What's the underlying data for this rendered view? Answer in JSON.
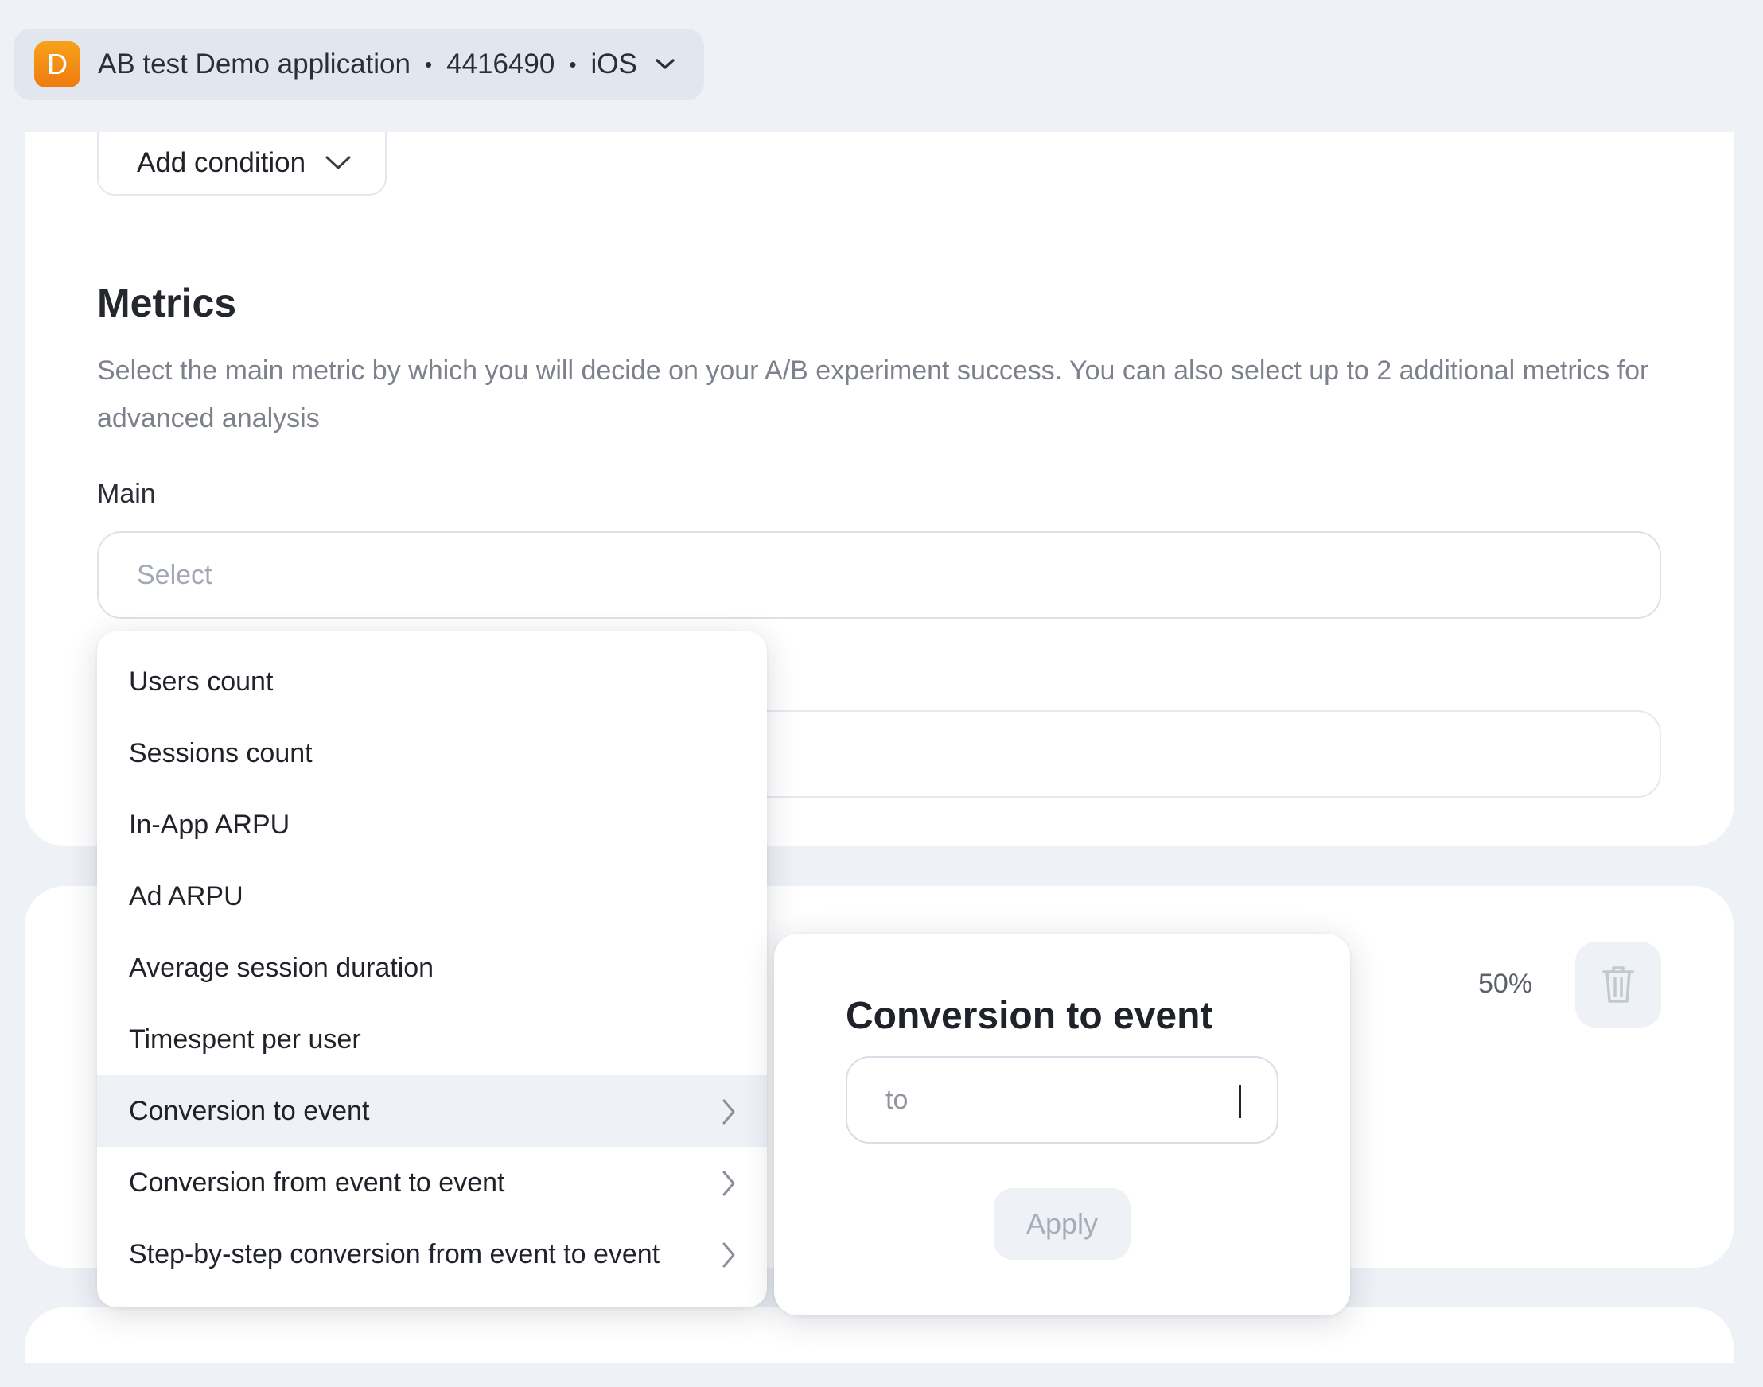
{
  "app_selector": {
    "avatar_letter": "D",
    "app_name": "AB test Demo application",
    "separator": "•",
    "app_id": "4416490",
    "platform": "iOS",
    "avatar_color": "#f08a14"
  },
  "conditions": {
    "add_label": "Add condition"
  },
  "metrics": {
    "title": "Metrics",
    "description": "Select the main metric by which you will decide on your A/B experiment success. You can also select up to 2 additional metrics for advanced analysis",
    "main_label": "Main",
    "main_placeholder": "Select",
    "menu_items": [
      {
        "label": "Users count",
        "has_submenu": false
      },
      {
        "label": "Sessions count",
        "has_submenu": false
      },
      {
        "label": "In-App ARPU",
        "has_submenu": false
      },
      {
        "label": "Ad ARPU",
        "has_submenu": false
      },
      {
        "label": "Average session duration",
        "has_submenu": false
      },
      {
        "label": "Timespent per user",
        "has_submenu": false
      },
      {
        "label": "Conversion to event",
        "has_submenu": true,
        "active": true
      },
      {
        "label": "Conversion from event to event",
        "has_submenu": true
      },
      {
        "label": "Step-by-step conversion from event to event",
        "has_submenu": true
      }
    ]
  },
  "popover": {
    "title": "Conversion to event",
    "input_placeholder": "to",
    "apply_label": "Apply"
  },
  "variants": {
    "split_value": "50%"
  },
  "colors": {
    "background": "#eef1f6",
    "card": "#ffffff",
    "active_item": "#eef1f6",
    "muted_text": "#7c818b"
  }
}
